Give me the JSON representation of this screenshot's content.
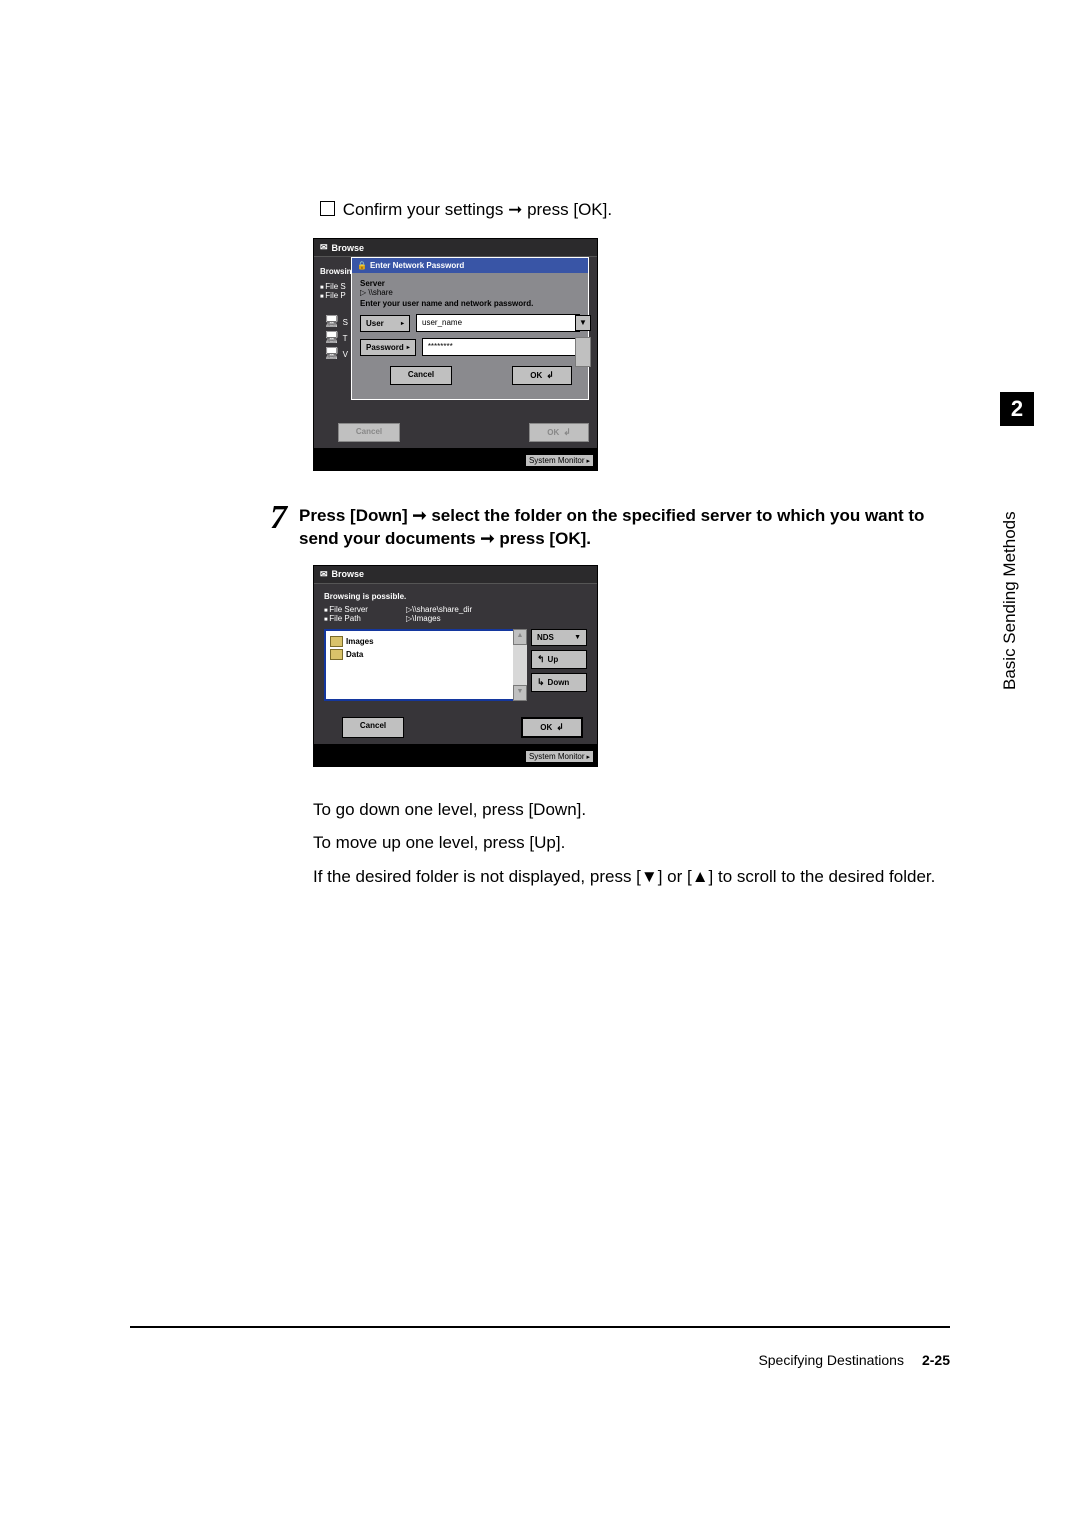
{
  "instruction_prefix": "Confirm your settings",
  "instruction_action": "press [OK].",
  "screenshot1": {
    "title": "Browse",
    "left_partial_line1": "File S",
    "left_partial_line2": "File P",
    "browsing_partial": "Browsin",
    "dialog_title": "Enter Network Password",
    "server_label": "Server",
    "server_value": "\\\\share",
    "prompt": "Enter your user name and network password.",
    "user_label": "User",
    "user_value": "user_name",
    "password_label": "Password",
    "password_value": "********",
    "cancel": "Cancel",
    "ok": "OK",
    "outer_cancel": "Cancel",
    "outer_ok": "OK",
    "system_monitor": "System Monitor"
  },
  "step": {
    "num": "7",
    "text_before": "Press [Down]",
    "text_mid": "select the folder on the specified server to which you want to send your documents",
    "text_after": "press [OK]."
  },
  "screenshot2": {
    "title": "Browse",
    "status": "Browsing is possible.",
    "file_server_label": "File Server",
    "file_server_value": "\\\\share\\share_dir",
    "file_path_label": "File Path",
    "file_path_value": "\\Images",
    "folders": [
      "Images",
      "Data"
    ],
    "dropdown": "NDS",
    "up": "Up",
    "down": "Down",
    "cancel": "Cancel",
    "ok": "OK",
    "system_monitor": "System Monitor"
  },
  "after1": "To go down one level, press [Down].",
  "after2": "To move up one level, press [Up].",
  "after3": "If the desired folder is not displayed, press [▼] or [▲] to scroll to the desired folder.",
  "side_tab_num": "2",
  "side_label": "Basic Sending Methods",
  "footer_section": "Specifying Destinations",
  "footer_page": "2-25"
}
